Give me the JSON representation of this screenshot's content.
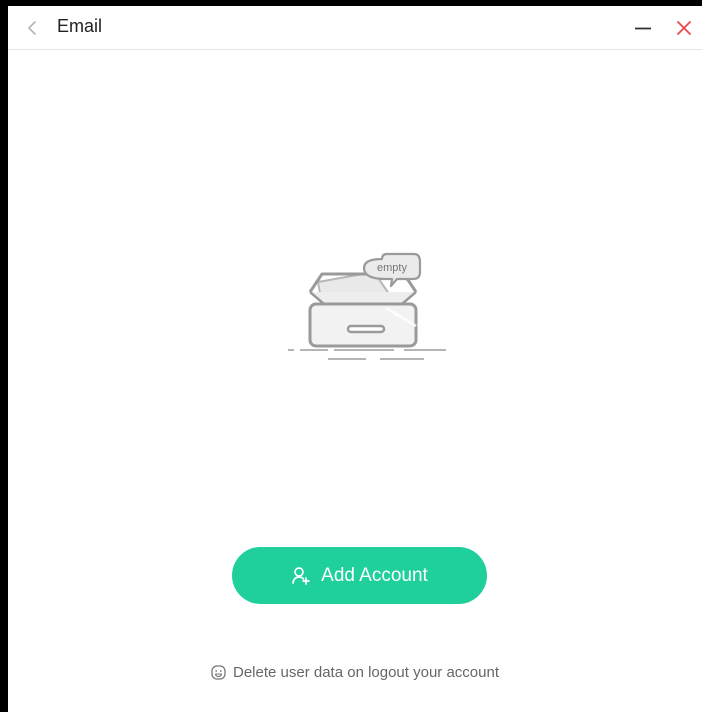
{
  "window": {
    "title": "Email"
  },
  "titlebar": {
    "back_icon": "chevron-left-icon",
    "minimize_icon": "minimize-icon",
    "close_icon": "close-icon",
    "close_color": "#e8474a"
  },
  "empty_state": {
    "illustration_icon": "empty-inbox-icon",
    "bubble_text": "empty"
  },
  "add_account_button": {
    "label": "Add Account",
    "icon": "add-user-icon",
    "color": "#1fcf9c"
  },
  "footer": {
    "icon": "smiley-icon",
    "text": "Delete user data on logout your account"
  }
}
